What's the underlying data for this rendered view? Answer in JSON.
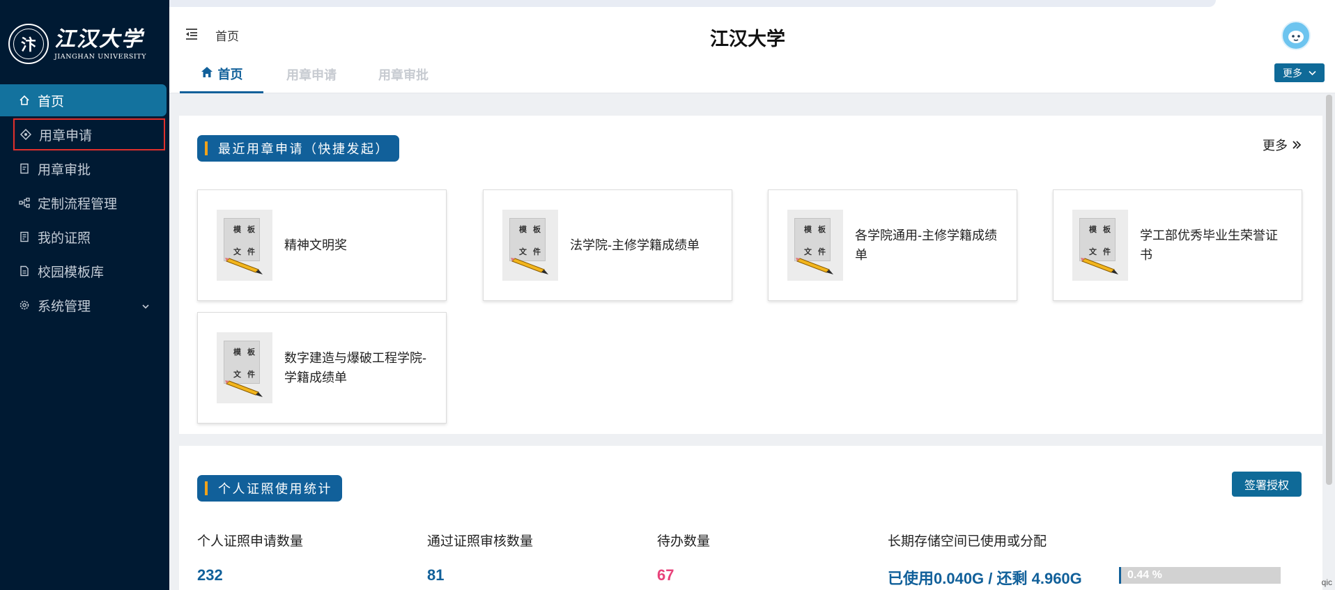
{
  "sidebar": {
    "brand_cn": "江汉大学",
    "brand_en": "JIANGHAN UNIVERSITY",
    "items": [
      {
        "label": "首页",
        "icon": "home-icon"
      },
      {
        "label": "用章申请",
        "icon": "target-icon"
      },
      {
        "label": "用章审批",
        "icon": "document-check-icon"
      },
      {
        "label": "定制流程管理",
        "icon": "flow-icon"
      },
      {
        "label": "我的证照",
        "icon": "certificate-icon"
      },
      {
        "label": "校园模板库",
        "icon": "template-icon"
      },
      {
        "label": "系统管理",
        "icon": "gear-icon"
      }
    ]
  },
  "header": {
    "breadcrumb": "首页",
    "title": "江汉大学"
  },
  "tabs": {
    "items": [
      "首页",
      "用章申请",
      "用章审批"
    ],
    "more": "更多"
  },
  "recent": {
    "title": "最近用章申请（快捷发起）",
    "more": "更多",
    "thumb_text": [
      "模",
      "板",
      "文",
      "件"
    ],
    "cards": [
      "精神文明奖",
      "法学院-主修学籍成绩单",
      "各学院通用-主修学籍成绩单",
      "学工部优秀毕业生荣誉证书",
      "数字建造与爆破工程学院-学籍成绩单"
    ]
  },
  "stats": {
    "title": "个人证照使用统计",
    "sign_button": "签署授权",
    "labels": [
      "个人证照申请数量",
      "通过证照审核数量",
      "待办数量",
      "长期存储空间已使用或分配"
    ],
    "values": [
      "232",
      "81",
      "67"
    ],
    "storage": "已使用0.040G / 还剩 4.960G",
    "progress_label": "0.44 %",
    "progress_percent": 0.44
  },
  "colors": {
    "sidebar_bg": "#001a33",
    "accent": "#11609a",
    "pending": "#e8427a",
    "highlight_box": "#e0302c"
  },
  "watermark": "qic"
}
